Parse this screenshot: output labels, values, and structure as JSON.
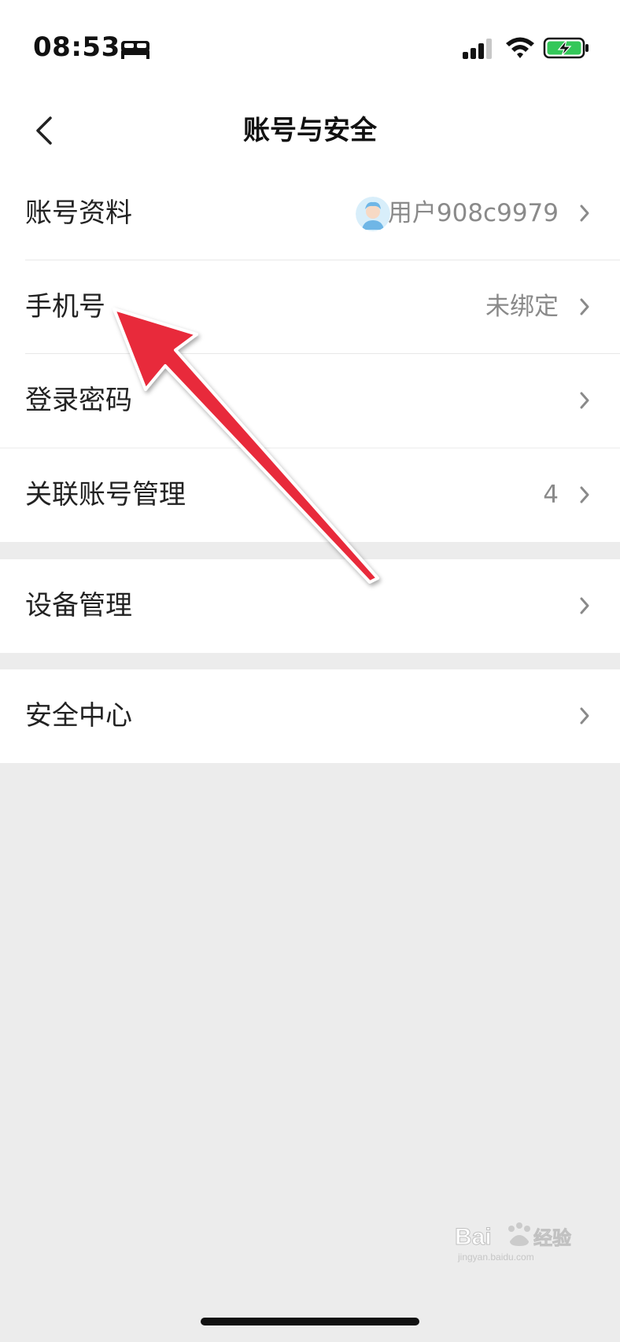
{
  "status_bar": {
    "time": "08:53",
    "icons": [
      "bed-icon",
      "cellular-signal-icon",
      "wifi-icon",
      "battery-charging-icon"
    ],
    "battery_color": "#34c759"
  },
  "nav": {
    "title": "账号与安全",
    "back_icon": "chevron-left-icon"
  },
  "groups": [
    {
      "items": [
        {
          "label": "账号资料",
          "value": "用户908c9979",
          "has_avatar": true
        },
        {
          "label": "手机号",
          "value": "未绑定"
        },
        {
          "label": "登录密码",
          "value": ""
        }
      ]
    },
    {
      "items": [
        {
          "label": "关联账号管理",
          "value": "4"
        }
      ]
    },
    {
      "items": [
        {
          "label": "设备管理",
          "value": ""
        }
      ]
    },
    {
      "items": [
        {
          "label": "安全中心",
          "value": ""
        }
      ]
    }
  ],
  "annotation": {
    "arrow_color": "#e8293a"
  },
  "watermark": {
    "brand": "Baidu经验",
    "site": "jingyan.baidu.com"
  }
}
